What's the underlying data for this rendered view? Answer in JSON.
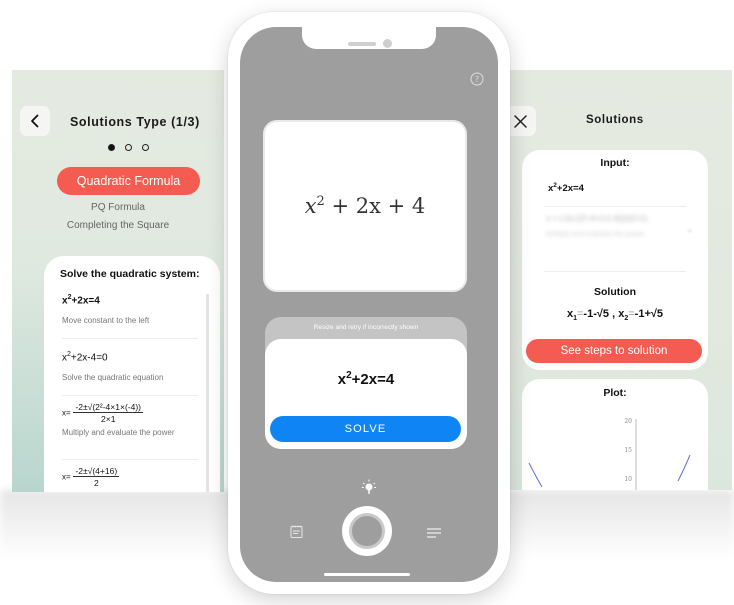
{
  "left_screen": {
    "title": "Solutions Type (1/3)",
    "pager": {
      "total": 3,
      "active": 1
    },
    "methods": {
      "selected": "Quadratic Formula",
      "others": [
        "PQ Formula",
        "Completing the Square"
      ]
    },
    "steps_card": {
      "heading": "Solve the quadratic system:",
      "steps": [
        {
          "eq_base": "x",
          "eq_sup": "2",
          "eq_rest": "+2x=4",
          "desc": "Move constant to the left"
        },
        {
          "eq_base": "x",
          "eq_sup": "2",
          "eq_rest": "+2x-4=0",
          "desc": "Solve the quadratic equation"
        },
        {
          "eq_lhs": "x=",
          "num": "-2±√(2²-4×1×(-4))",
          "den": "2×1",
          "desc": "Multiply and evaluate the power"
        },
        {
          "eq_lhs": "x=",
          "num": "-2±√(4+16)",
          "den": "2"
        }
      ]
    }
  },
  "phone": {
    "captured_formula": {
      "base": "x",
      "sup": "2",
      "rest": " + 2x + 4"
    },
    "hint": "Resize and retry if incorrectly shown",
    "recognized": {
      "base": "x",
      "sup": "2",
      "rest": "+2x=4"
    },
    "solve_label": "SOLVE",
    "icons": [
      "help-icon",
      "flash-icon",
      "history-icon",
      "shutter-button",
      "menu-icon"
    ]
  },
  "right_screen": {
    "title": "Solutions",
    "input_label": "Input:",
    "input_eq": {
      "base": "x",
      "sup": "2",
      "rest": "+2x=4"
    },
    "blurred_step": {
      "eq": "x = (-2±√(2²-4×1×(-4)))/(2×1)",
      "desc": "Multiply and evaluate the power"
    },
    "solution_label": "Solution",
    "solution": {
      "x1": "-1-√5",
      "x2": "-1+√5"
    },
    "steps_button": "See steps to solution",
    "plot_label": "Plot:",
    "plot": {
      "y_ticks": [
        "20",
        "15",
        "10"
      ]
    }
  },
  "colors": {
    "accent_red": "#f45c52",
    "solve_blue": "#0f85f5",
    "panel_green": "#e2e9df",
    "camera_gray": "#9e9e9e"
  }
}
